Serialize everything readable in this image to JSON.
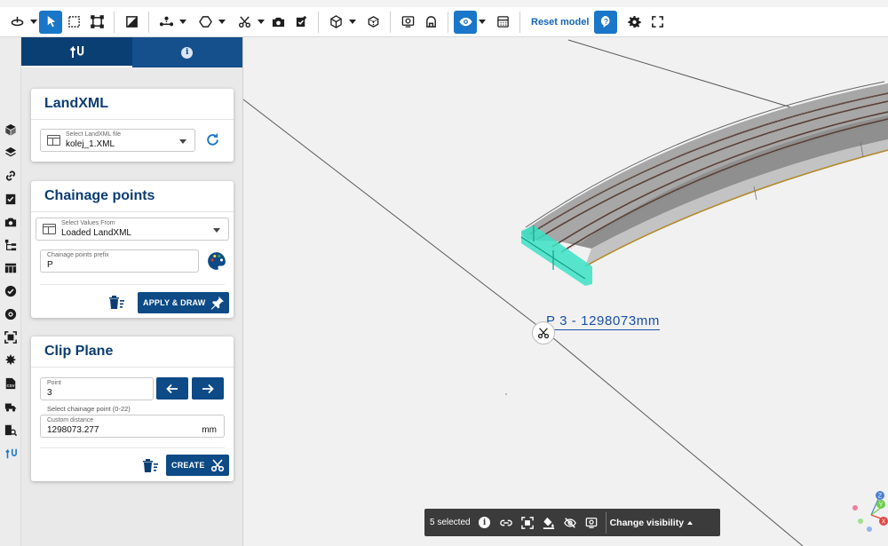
{
  "toolbar": {
    "reset_label": "Reset model",
    "accent": "#1976c8"
  },
  "tabs": [
    {
      "name": "landxml-tab-icon",
      "active": true
    },
    {
      "name": "info-tab-icon",
      "active": false,
      "glyph": "i"
    }
  ],
  "landxml": {
    "title": "LandXML",
    "file_label": "Select LandXML file",
    "file_value": "kolej_1.XML"
  },
  "chainage": {
    "title": "Chainage points",
    "values_label": "Select Values From",
    "values_value": "Loaded LandXML",
    "prefix_label": "Chainage points prefix",
    "prefix_value": "P",
    "apply_label": "APPLY & DRAW"
  },
  "clip": {
    "title": "Clip Plane",
    "point_label": "Point",
    "point_value": "3",
    "point_hint": "Select chainage point (0-22)",
    "distance_label": "Custom distance",
    "distance_value": "1298073.277",
    "distance_unit": "mm",
    "create_label": "CREATE"
  },
  "viewport": {
    "chainage_label": "P 3 - 1298073mm",
    "label_color": "#1850a6",
    "highlight_color": "#3be3c5"
  },
  "selection": {
    "count_label": "5 selected",
    "info_glyph": "i",
    "visibility_label": "Change visibility"
  },
  "gizmo": {
    "axes": [
      "Z",
      "Y",
      "X"
    ]
  },
  "rail": {
    "csv_label": "CSV"
  }
}
